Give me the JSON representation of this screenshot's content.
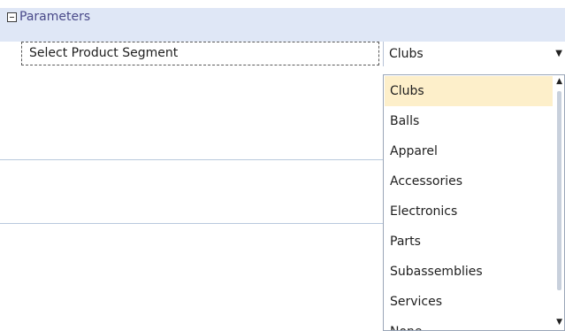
{
  "section": {
    "title": "Parameters",
    "collapse_icon": "minus-box-icon"
  },
  "parameter": {
    "label": "Select Product Segment",
    "selected_value": "Clubs",
    "dropdown_arrow_icon": "dropdown-arrow-icon"
  },
  "dropdown": {
    "options": [
      "Clubs",
      "Balls",
      "Apparel",
      "Accessories",
      "Electronics",
      "Parts",
      "Subassemblies",
      "Services",
      "None"
    ],
    "selected_index": 0
  },
  "colors": {
    "header_background": "#dfe7f6",
    "selected_option_background": "#fdefca",
    "divider": "#b9c9dd"
  }
}
